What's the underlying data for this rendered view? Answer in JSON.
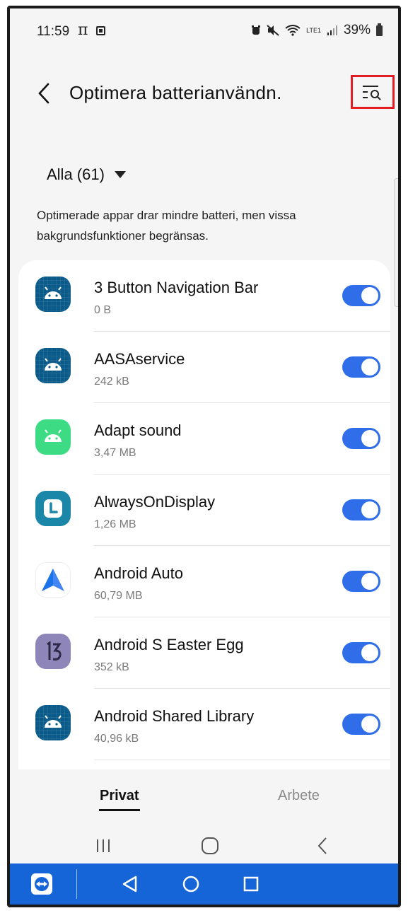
{
  "status_bar": {
    "time": "11:59",
    "pi_symbol": "π",
    "battery_percent": "39%",
    "network_label": "LTE1"
  },
  "header": {
    "title": "Optimera batterianvändn."
  },
  "filter": {
    "label": "Alla (61)"
  },
  "description": "Optimerade appar drar mindre batteri, men vissa bakgrundsfunktioner begränsas.",
  "apps": [
    {
      "name": "3 Button Navigation Bar",
      "size": "0 B",
      "icon": "android-robot-icon",
      "icon_color": "#0b5b8a",
      "optimized": true
    },
    {
      "name": "AASAservice",
      "size": "242 kB",
      "icon": "android-robot-icon",
      "icon_color": "#0b5b8a",
      "optimized": true
    },
    {
      "name": "Adapt sound",
      "size": "3,47 MB",
      "icon": "android-robot-icon",
      "icon_color": "#3ddc84",
      "optimized": true
    },
    {
      "name": "AlwaysOnDisplay",
      "size": "1,26 MB",
      "icon": "clock-icon",
      "icon_color": "#1a86a8",
      "optimized": true
    },
    {
      "name": "Android Auto",
      "size": "60,79 MB",
      "icon": "android-auto-icon",
      "icon_color": "#4285f4",
      "optimized": true
    },
    {
      "name": "Android S Easter Egg",
      "size": "352 kB",
      "icon": "easter-egg-13-icon",
      "icon_color": "#8e86b8",
      "optimized": true
    },
    {
      "name": "Android Shared Library",
      "size": "40,96 kB",
      "icon": "android-robot-icon",
      "icon_color": "#0b5b8a",
      "optimized": true
    }
  ],
  "tabs": {
    "private": "Privat",
    "work": "Arbete"
  },
  "colors": {
    "toggle_on": "#2f6ee8",
    "highlight_box": "#e21c23",
    "remote_bar": "#1565d8"
  }
}
